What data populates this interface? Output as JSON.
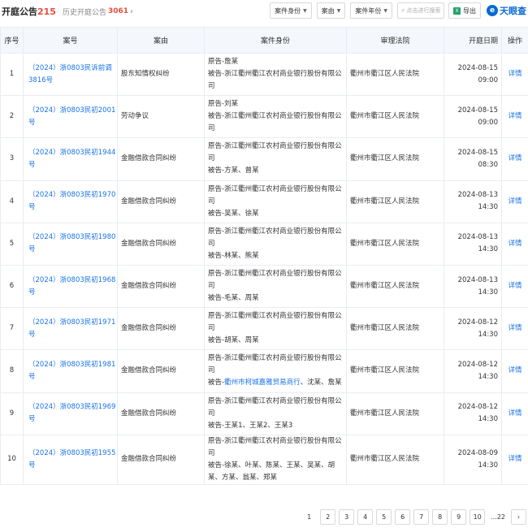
{
  "header": {
    "title": "开庭公告",
    "count": "215",
    "history_label": "历史开庭公告",
    "history_count": "3061",
    "history_chevron": "›",
    "filters": [
      {
        "label": "案件身份"
      },
      {
        "label": "案由"
      },
      {
        "label": "案件年份"
      }
    ],
    "search_placeholder": "点击进行搜索",
    "export_label": "导出",
    "brand": "天眼查"
  },
  "table": {
    "columns": [
      "序号",
      "案号",
      "案由",
      "案件身份",
      "审理法院",
      "开庭日期",
      "操作"
    ],
    "rows": [
      {
        "no": "1",
        "case": "（2024）浙0803民诉前调3816号",
        "reason": "股东知情权纠纷",
        "plaintiff": "原告-詹某",
        "defendant": "被告-浙江衢州衢江农村商业银行股份有限公司",
        "court": "衢州市衢江区人民法院",
        "date": "2024-08-15 09:00",
        "op": "详情"
      },
      {
        "no": "2",
        "case": "（2024）浙0803民初2001号",
        "reason": "劳动争议",
        "plaintiff": "原告-刘某",
        "defendant": "被告-浙江衢州衢江农村商业银行股份有限公司",
        "court": "衢州市衢江区人民法院",
        "date": "2024-08-15 09:00",
        "op": "详情"
      },
      {
        "no": "3",
        "case": "（2024）浙0803民初1944号",
        "reason": "金融借款合同纠纷",
        "plaintiff": "原告-浙江衢州衢江农村商业银行股份有限公司",
        "defendant": "被告-方某、曾某",
        "court": "衢州市衢江区人民法院",
        "date": "2024-08-15 08:30",
        "op": "详情"
      },
      {
        "no": "4",
        "case": "（2024）浙0803民初1970号",
        "reason": "金融借款合同纠纷",
        "plaintiff": "原告-浙江衢州衢江农村商业银行股份有限公司",
        "defendant": "被告-吴某、徐某",
        "court": "衢州市衢江区人民法院",
        "date": "2024-08-13 14:30",
        "op": "详情"
      },
      {
        "no": "5",
        "case": "（2024）浙0803民初1980号",
        "reason": "金融借款合同纠纷",
        "plaintiff": "原告-浙江衢州衢江农村商业银行股份有限公司",
        "defendant": "被告-林某、熊某",
        "court": "衢州市衢江区人民法院",
        "date": "2024-08-13 14:30",
        "op": "详情"
      },
      {
        "no": "6",
        "case": "（2024）浙0803民初1968号",
        "reason": "金融借款合同纠纷",
        "plaintiff": "原告-浙江衢州衢江农村商业银行股份有限公司",
        "defendant": "被告-毛某、周某",
        "court": "衢州市衢江区人民法院",
        "date": "2024-08-13 14:30",
        "op": "详情"
      },
      {
        "no": "7",
        "case": "（2024）浙0803民初1971号",
        "reason": "金融借款合同纠纷",
        "plaintiff": "原告-浙江衢州衢江农村商业银行股份有限公司",
        "defendant": "被告-胡某、周某",
        "court": "衢州市衢江区人民法院",
        "date": "2024-08-12 14:30",
        "op": "详情"
      },
      {
        "no": "8",
        "case": "（2024）浙0803民初1981号",
        "reason": "金融借款合同纠纷",
        "plaintiff": "原告-浙江衢州衢江农村商业银行股份有限公司",
        "defendant_prefix": "被告-",
        "defendant_link": "衢州市柯城嘉雅贸易商行",
        "defendant_rest": "、沈某、詹某",
        "court": "衢州市衢江区人民法院",
        "date": "2024-08-12 14:30",
        "op": "详情"
      },
      {
        "no": "9",
        "case": "（2024）浙0803民初1969号",
        "reason": "金融借款合同纠纷",
        "plaintiff": "原告-浙江衢州衢江农村商业银行股份有限公司",
        "defendant": "被告-王某1、王某2、王某3",
        "court": "衢州市衢江区人民法院",
        "date": "2024-08-12 14:30",
        "op": "详情"
      },
      {
        "no": "10",
        "case": "（2024）浙0803民初1955号",
        "reason": "金融借款合同纠纷",
        "plaintiff": "原告-浙江衢州衢江农村商业银行股份有限公司",
        "defendant": "被告-徐某、叶某、陈某、王某、吴某、胡某、方某、翁某、郑某",
        "court": "衢州市衢江区人民法院",
        "date": "2024-08-09 14:30",
        "op": "详情"
      }
    ]
  },
  "pagination": {
    "pages": [
      "1",
      "2",
      "3",
      "4",
      "5",
      "6",
      "7",
      "8",
      "9",
      "10"
    ],
    "current": "1",
    "ellipsis_last": "...22",
    "next": "›"
  }
}
